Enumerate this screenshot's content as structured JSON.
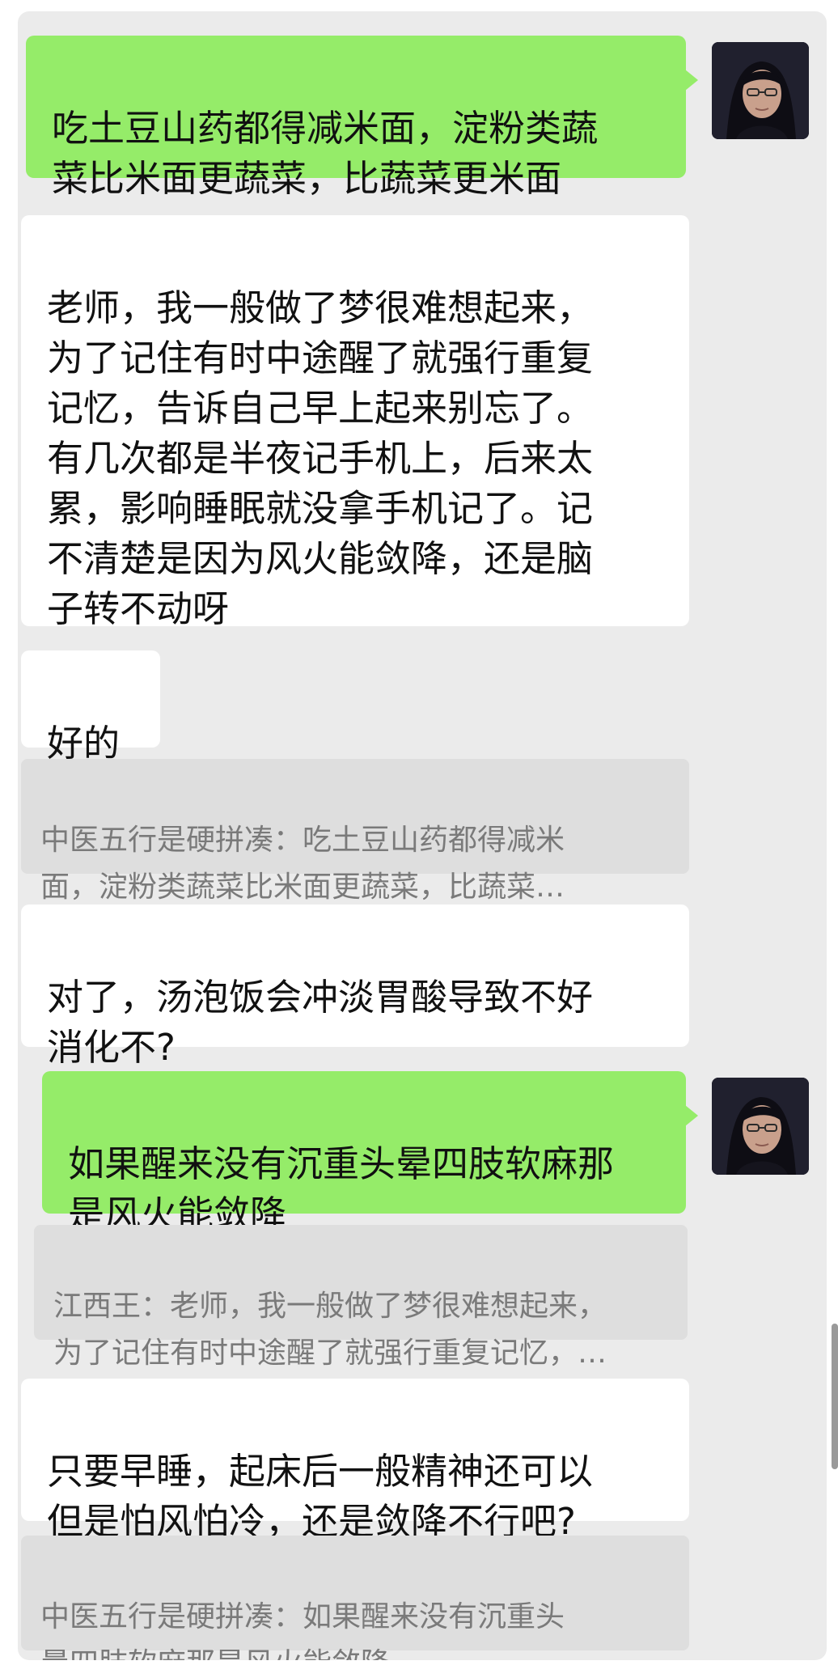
{
  "messages": [
    {
      "side": "out",
      "text": "吃土豆山药都得减米面，淀粉类蔬\n菜比米面更蔬菜，比蔬菜更米面"
    },
    {
      "side": "in",
      "text": "老师，我一般做了梦很难想起来，\n为了记住有时中途醒了就强行重复\n记忆，告诉自己早上起来别忘了。\n有几次都是半夜记手机上，后来太\n累，影响睡眠就没拿手机记了。记\n不清楚是因为风火能敛降，还是脑\n子转不动呀"
    },
    {
      "side": "in",
      "text": "好的"
    },
    {
      "type": "quote",
      "text": "中医五行是硬拼凑：吃土豆山药都得减米\n面，淀粉类蔬菜比米面更蔬菜，比蔬菜…"
    },
    {
      "side": "in",
      "text": "对了，汤泡饭会冲淡胃酸导致不好\n消化不?"
    },
    {
      "side": "out",
      "text": "如果醒来没有沉重头晕四肢软麻那\n是风火能敛降"
    },
    {
      "type": "quote",
      "text": "江西王：老师，我一般做了梦很难想起来，\n为了记住有时中途醒了就强行重复记忆，…"
    },
    {
      "side": "in",
      "text": "只要早睡，起床后一般精神还可以\n但是怕风怕冷，还是敛降不行吧?"
    },
    {
      "type": "quote",
      "text": "中医五行是硬拼凑：如果醒来没有沉重头\n晕四肢软麻那是风火能敛降"
    }
  ],
  "colors": {
    "outgoing_bubble": "#95ec69",
    "incoming_bubble": "#ffffff",
    "quote_bubble": "#dedede",
    "chat_background": "#ebebeb"
  }
}
